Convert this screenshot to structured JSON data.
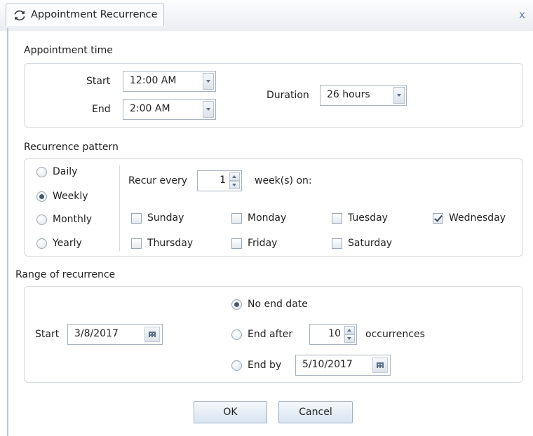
{
  "window": {
    "title": "Appointment Recurrence",
    "close_label": "x"
  },
  "appointment_time": {
    "section_label": "Appointment time",
    "start_label": "Start",
    "start_value": "12:00 AM",
    "end_label": "End",
    "end_value": "2:00 AM",
    "duration_label": "Duration",
    "duration_value": "26 hours"
  },
  "recurrence_pattern": {
    "section_label": "Recurrence pattern",
    "frequencies": [
      {
        "label": "Daily",
        "checked": false
      },
      {
        "label": "Weekly",
        "checked": true
      },
      {
        "label": "Monthly",
        "checked": false
      },
      {
        "label": "Yearly",
        "checked": false
      }
    ],
    "recur_every_label": "Recur every",
    "recur_every_value": "1",
    "weeks_on_label": "week(s) on:",
    "days": [
      {
        "label": "Sunday",
        "checked": false
      },
      {
        "label": "Monday",
        "checked": false
      },
      {
        "label": "Tuesday",
        "checked": false
      },
      {
        "label": "Wednesday",
        "checked": true
      },
      {
        "label": "Thursday",
        "checked": false
      },
      {
        "label": "Friday",
        "checked": false
      },
      {
        "label": "Saturday",
        "checked": false
      }
    ]
  },
  "range": {
    "section_label": "Range of recurrence",
    "start_label": "Start",
    "start_value": "3/8/2017",
    "no_end_label": "No end date",
    "end_after_label": "End after",
    "end_after_value": "10",
    "occurrences_label": "occurrences",
    "end_by_label": "End by",
    "end_by_value": "5/10/2017",
    "selected": "no_end"
  },
  "buttons": {
    "ok": "OK",
    "cancel": "Cancel"
  }
}
